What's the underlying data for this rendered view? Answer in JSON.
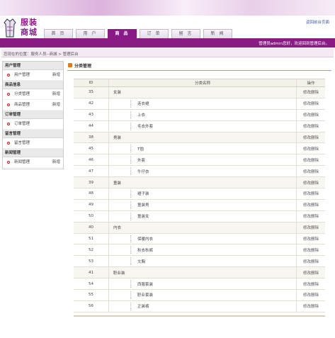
{
  "header": {
    "logo_text_line1": "服装",
    "logo_text_line2": "商城",
    "back_link": "返回前台页面",
    "user_info": "管理员admin您好，欢迎回到管理后台。"
  },
  "nav": {
    "tabs": [
      {
        "label": "首 页",
        "active": false
      },
      {
        "label": "用 户",
        "active": false
      },
      {
        "label": "商 品",
        "active": true
      },
      {
        "label": "订 单",
        "active": false
      },
      {
        "label": "留 言",
        "active": false
      },
      {
        "label": "新 闻",
        "active": false
      }
    ]
  },
  "breadcrumb": {
    "prefix": "您现在的位置：",
    "site": "服务人员--商城",
    "sep": " > ",
    "current": "管理后台"
  },
  "sidebar": {
    "groups": [
      {
        "title": "用户管理",
        "items": [
          {
            "label": "用户管理",
            "add": "新增"
          }
        ]
      },
      {
        "title": "商品信息",
        "items": [
          {
            "label": "分类管理",
            "add": "新增"
          },
          {
            "label": "商品管理",
            "add": "新增"
          }
        ]
      },
      {
        "title": "订单管理",
        "items": [
          {
            "label": "订单管理",
            "add": ""
          }
        ]
      },
      {
        "title": "留言管理",
        "items": [
          {
            "label": "留言管理",
            "add": ""
          }
        ]
      },
      {
        "title": "新闻管理",
        "items": [
          {
            "label": "新闻管理",
            "add": "新增"
          }
        ]
      }
    ]
  },
  "main": {
    "title": "分类管理",
    "columns": {
      "id": "ID",
      "name": "分类名称",
      "ops": "操作"
    },
    "op_edit": "修改",
    "op_delete": "删除",
    "rows": [
      {
        "id": "35",
        "name": "女装",
        "level": 0
      },
      {
        "id": "42",
        "name": "连衣裙",
        "level": 1
      },
      {
        "id": "43",
        "name": "上衣",
        "level": 1
      },
      {
        "id": "44",
        "name": "毛衣外套",
        "level": 1
      },
      {
        "id": "38",
        "name": "男装",
        "level": 0
      },
      {
        "id": "45",
        "name": "T恤",
        "level": 1
      },
      {
        "id": "46",
        "name": "外套",
        "level": 1
      },
      {
        "id": "47",
        "name": "牛仔衣",
        "level": 1
      },
      {
        "id": "39",
        "name": "童装",
        "level": 0
      },
      {
        "id": "48",
        "name": "裙子装",
        "level": 1
      },
      {
        "id": "49",
        "name": "童装男",
        "level": 1
      },
      {
        "id": "50",
        "name": "童装女",
        "level": 1
      },
      {
        "id": "40",
        "name": "内衣",
        "level": 0
      },
      {
        "id": "51",
        "name": "保暖内衣",
        "level": 1
      },
      {
        "id": "52",
        "name": "秋衣秋裤",
        "level": 1
      },
      {
        "id": "53",
        "name": "文胸",
        "level": 1
      },
      {
        "id": "41",
        "name": "职业装",
        "level": 0
      },
      {
        "id": "54",
        "name": "西服套装",
        "level": 1
      },
      {
        "id": "55",
        "name": "职业套装",
        "level": 1
      },
      {
        "id": "56",
        "name": "正装裤",
        "level": 1
      }
    ]
  },
  "colors": {
    "brand": "#8a1b86",
    "accent": "#e07a20"
  }
}
